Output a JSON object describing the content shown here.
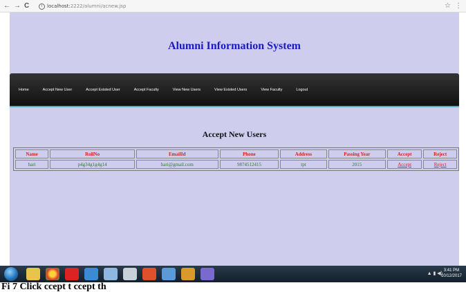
{
  "browser": {
    "back": "←",
    "forward": "→",
    "reload": "C",
    "url_host": "localhost:",
    "url_path": "2222/alumni/acnew.jsp",
    "star": "☆",
    "menu": "⋮"
  },
  "app": {
    "title": "Alumni Information System"
  },
  "nav": {
    "items": [
      "Home",
      "Accept New User",
      "Accept Existed User",
      "Accept Faculty",
      "View New Users",
      "View Existed Users",
      "View Faculty",
      "Logout"
    ]
  },
  "section": {
    "title": "Accept New Users"
  },
  "table": {
    "headers": [
      "Name",
      "RollNo",
      "EmailId",
      "Phone",
      "Address",
      "Passing Year",
      "Accept",
      "Reject"
    ],
    "rows": [
      {
        "name": "hari",
        "rollno": "p4g34g1g4g14",
        "email": "hari@gmail.com",
        "phone": "9874512415",
        "address": "tpt",
        "passing_year": "2015",
        "accept": "Accept",
        "reject": "Reject"
      }
    ]
  },
  "taskbar": {
    "time": "3:41 PM",
    "date": "10/12/2017"
  },
  "caption": "Fi 7  Click            ccept t            ccept th"
}
